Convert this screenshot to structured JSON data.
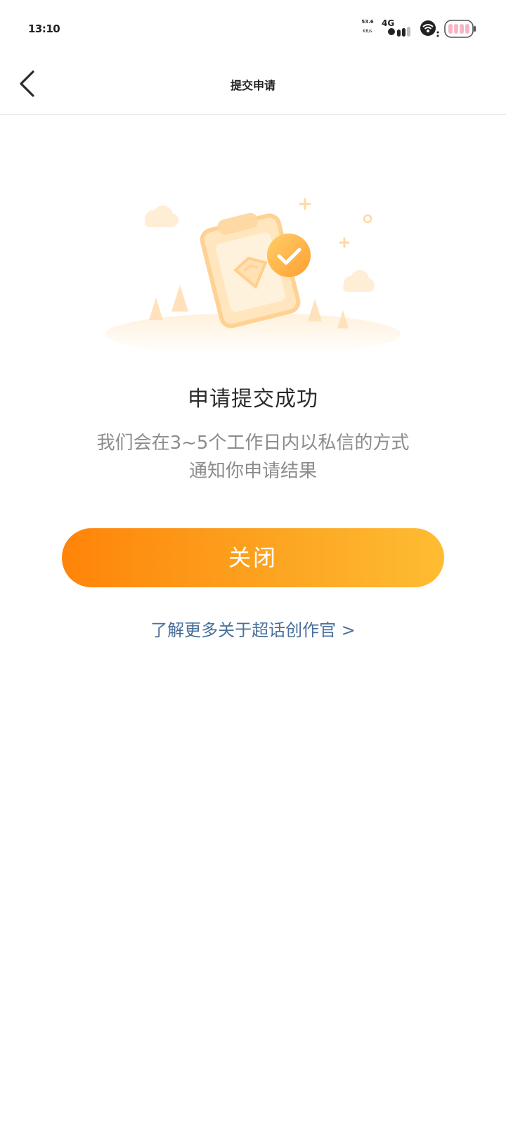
{
  "status_bar": {
    "time": "13:10",
    "net_speed_value": "53.6",
    "net_speed_unit": "KB/s",
    "network_type": "4G",
    "icons": [
      "signal-icon",
      "wifi-icon",
      "battery-icon"
    ]
  },
  "nav": {
    "title": "提交申请",
    "back_icon": "chevron-left-icon"
  },
  "illustration": {
    "name": "clipboard-check-illustration",
    "accent_color": "#ffa940"
  },
  "result": {
    "title": "申请提交成功",
    "description_line1": "我们会在3~5个工作日内以私信的方式",
    "description_line2": "通知你申请结果"
  },
  "actions": {
    "close_label": "关闭",
    "learn_more_label": "了解更多关于超话创作官 >"
  },
  "colors": {
    "button_gradient_start": "#ff8409",
    "button_gradient_end": "#ffbc33",
    "link": "#4a6f9b",
    "description": "#8c8c8c"
  }
}
